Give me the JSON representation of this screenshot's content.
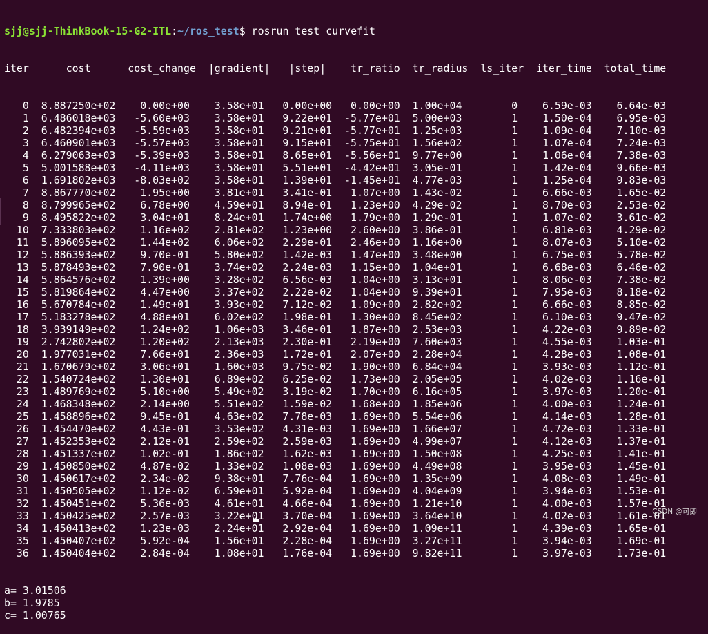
{
  "prompt": {
    "user_host": "sjj@sjj-ThinkBook-15-G2-ITL",
    "separator": ":",
    "path": "~/ros_test",
    "symbol": "$ ",
    "command": "rosrun test curvefit"
  },
  "table": {
    "header": "iter      cost      cost_change  |gradient|   |step|    tr_ratio  tr_radius  ls_iter  iter_time  total_time",
    "rows": [
      "   0  8.887250e+02    0.00e+00    3.58e+01   0.00e+00   0.00e+00  1.00e+04        0    6.59e-03    6.64e-03",
      "   1  6.486018e+03   -5.60e+03    3.58e+01   9.22e+01  -5.77e+01  5.00e+03        1    1.50e-04    6.95e-03",
      "   2  6.482394e+03   -5.59e+03    3.58e+01   9.21e+01  -5.77e+01  1.25e+03        1    1.09e-04    7.10e-03",
      "   3  6.460901e+03   -5.57e+03    3.58e+01   9.15e+01  -5.75e+01  1.56e+02        1    1.07e-04    7.24e-03",
      "   4  6.279063e+03   -5.39e+03    3.58e+01   8.65e+01  -5.56e+01  9.77e+00        1    1.06e-04    7.38e-03",
      "   5  5.001588e+03   -4.11e+03    3.58e+01   5.51e+01  -4.42e+01  3.05e-01        1    1.42e-04    9.66e-03",
      "   6  1.691802e+03   -8.03e+02    3.58e+01   1.39e+01  -1.45e+01  4.77e-03        1    1.25e-04    9.83e-03",
      "   7  8.867770e+02    1.95e+00    3.81e+01   3.41e-01   1.07e+00  1.43e-02        1    6.66e-03    1.65e-02",
      "   8  8.799965e+02    6.78e+00    4.59e+01   8.94e-01   1.23e+00  4.29e-02        1    8.70e-03    2.53e-02",
      "   9  8.495822e+02    3.04e+01    8.24e+01   1.74e+00   1.79e+00  1.29e-01        1    1.07e-02    3.61e-02",
      "  10  7.333803e+02    1.16e+02    2.81e+02   1.23e+00   2.60e+00  3.86e-01        1    6.81e-03    4.29e-02",
      "  11  5.896095e+02    1.44e+02    6.06e+02   2.29e-01   2.46e+00  1.16e+00        1    8.07e-03    5.10e-02",
      "  12  5.886393e+02    9.70e-01    5.80e+02   1.42e-03   1.47e+00  3.48e+00        1    6.75e-03    5.78e-02",
      "  13  5.878493e+02    7.90e-01    3.74e+02   2.24e-03   1.15e+00  1.04e+01        1    6.68e-03    6.46e-02",
      "  14  5.864576e+02    1.39e+00    3.28e+02   6.56e-03   1.04e+00  3.13e+01        1    8.06e-03    7.38e-02",
      "  15  5.819864e+02    4.47e+00    3.37e+02   2.22e-02   1.04e+00  9.39e+01        1    7.95e-03    8.18e-02",
      "  16  5.670784e+02    1.49e+01    3.93e+02   7.12e-02   1.09e+00  2.82e+02        1    6.66e-03    8.85e-02",
      "  17  5.183278e+02    4.88e+01    6.02e+02   1.98e-01   1.30e+00  8.45e+02        1    6.10e-03    9.47e-02",
      "  18  3.939149e+02    1.24e+02    1.06e+03   3.46e-01   1.87e+00  2.53e+03        1    4.22e-03    9.89e-02",
      "  19  2.742802e+02    1.20e+02    2.13e+03   2.30e-01   2.19e+00  7.60e+03        1    4.55e-03    1.03e-01",
      "  20  1.977031e+02    7.66e+01    2.36e+03   1.72e-01   2.07e+00  2.28e+04        1    4.28e-03    1.08e-01",
      "  21  1.670679e+02    3.06e+01    1.60e+03   9.75e-02   1.90e+00  6.84e+04        1    3.93e-03    1.12e-01",
      "  22  1.540724e+02    1.30e+01    6.89e+02   6.25e-02   1.73e+00  2.05e+05        1    4.02e-03    1.16e-01",
      "  23  1.489769e+02    5.10e+00    5.49e+02   3.19e-02   1.70e+00  6.16e+05        1    3.97e-03    1.20e-01",
      "  24  1.468348e+02    2.14e+00    5.51e+02   1.59e-02   1.68e+00  1.85e+06        1    4.00e-03    1.24e-01",
      "  25  1.458896e+02    9.45e-01    4.63e+02   7.78e-03   1.69e+00  5.54e+06        1    4.14e-03    1.28e-01",
      "  26  1.454470e+02    4.43e-01    3.53e+02   4.31e-03   1.69e+00  1.66e+07        1    4.72e-03    1.33e-01",
      "  27  1.452353e+02    2.12e-01    2.59e+02   2.59e-03   1.69e+00  4.99e+07        1    4.12e-03    1.37e-01",
      "  28  1.451337e+02    1.02e-01    1.86e+02   1.62e-03   1.69e+00  1.50e+08        1    4.25e-03    1.41e-01",
      "  29  1.450850e+02    4.87e-02    1.33e+02   1.08e-03   1.69e+00  4.49e+08        1    3.95e-03    1.45e-01",
      "  30  1.450617e+02    2.34e-02    9.38e+01   7.76e-04   1.69e+00  1.35e+09        1    4.08e-03    1.49e-01",
      "  31  1.450505e+02    1.12e-02    6.59e+01   5.92e-04   1.69e+00  4.04e+09        1    3.94e-03    1.53e-01",
      "  32  1.450451e+02    5.36e-03    4.61e+01   4.66e-04   1.69e+00  1.21e+10        1    4.00e-03    1.57e-01",
      "  33  1.450425e+02    2.57e-03    3.22e+01   3.70e-04   1.69e+00  3.64e+10        1    4.02e-03    1.61e-01",
      "  34  1.450413e+02    1.23e-03    2.24e+01   2.92e-04   1.69e+00  1.09e+11        1    4.39e-03    1.65e-01",
      "  35  1.450407e+02    5.92e-04    1.56e+01   2.28e-04   1.69e+00  3.27e+11        1    3.94e-03    1.69e-01",
      "  36  1.450404e+02    2.84e-04    1.08e+01   1.76e-04   1.69e+00  9.82e+11        1    3.97e-03    1.73e-01"
    ]
  },
  "results": [
    "a= 3.01506",
    "b= 1.9785",
    "c= 1.00765"
  ],
  "watermark": "CSDN @可即",
  "colors": {
    "background": "#300a24",
    "text": "#ffffff",
    "user_host": "#8ae234",
    "path": "#729fcf"
  }
}
